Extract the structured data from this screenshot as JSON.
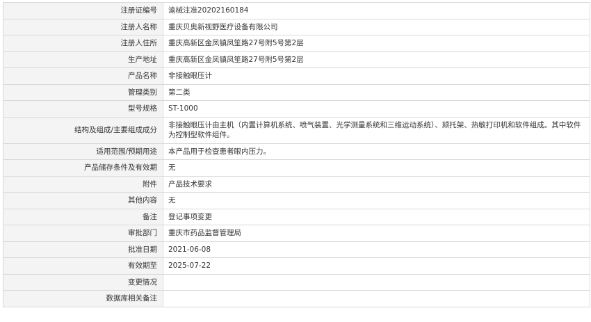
{
  "rows": [
    {
      "label": "注册证编号",
      "value": "渝械注准20202160184"
    },
    {
      "label": "注册人名称",
      "value": "重庆贝奥新视野医疗设备有限公司"
    },
    {
      "label": "注册人住所",
      "value": "重庆高新区金凤镇凤笙路27号附5号第2层"
    },
    {
      "label": "生产地址",
      "value": "重庆高新区金凤镇凤笙路27号附5号第2层"
    },
    {
      "label": "产品名称",
      "value": "非接触眼压计"
    },
    {
      "label": "管理类别",
      "value": "第二类"
    },
    {
      "label": "型号规格",
      "value": "ST-1000"
    },
    {
      "label": "结构及组成/主要组成成分",
      "value": "非接触眼压计由主机（内置计算机系统、喷气装置、光学测量系统和三维运动系统）、颏托架、热敏打印机和软件组成。其中软件为控制型软件组件。"
    },
    {
      "label": "适用范围/预期用途",
      "value": "本产品用于检查患者眼内压力。"
    },
    {
      "label": "产品储存条件及有效期",
      "value": "无"
    },
    {
      "label": "附件",
      "value": "产品技术要求"
    },
    {
      "label": "其他内容",
      "value": "无"
    },
    {
      "label": "备注",
      "value": "登记事项变更"
    },
    {
      "label": "审批部门",
      "value": "重庆市药品监督管理局"
    },
    {
      "label": "批准日期",
      "value": "2021-06-08"
    },
    {
      "label": "有效期至",
      "value": "2025-07-22"
    },
    {
      "label": "变更情况",
      "value": ""
    },
    {
      "label": "数据库相关备注",
      "value": ""
    }
  ]
}
